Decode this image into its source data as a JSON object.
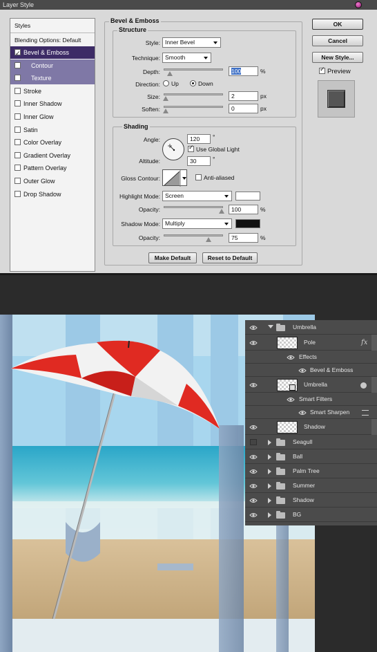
{
  "dialog": {
    "title": "Layer Style",
    "styles_panel": {
      "header": "Styles",
      "blending": "Blending Options: Default",
      "items": [
        {
          "label": "Bevel & Emboss",
          "checked": true,
          "selected": true
        },
        {
          "label": "Contour",
          "checked": false,
          "sub": true
        },
        {
          "label": "Texture",
          "checked": false,
          "sub": true
        },
        {
          "label": "Stroke",
          "checked": false
        },
        {
          "label": "Inner Shadow",
          "checked": false
        },
        {
          "label": "Inner Glow",
          "checked": false
        },
        {
          "label": "Satin",
          "checked": false
        },
        {
          "label": "Color Overlay",
          "checked": false
        },
        {
          "label": "Gradient Overlay",
          "checked": false
        },
        {
          "label": "Pattern Overlay",
          "checked": false
        },
        {
          "label": "Outer Glow",
          "checked": false
        },
        {
          "label": "Drop Shadow",
          "checked": false
        }
      ]
    },
    "bevel": {
      "section_title": "Bevel & Emboss",
      "structure_title": "Structure",
      "style_label": "Style:",
      "style_value": "Inner Bevel",
      "technique_label": "Technique:",
      "technique_value": "Smooth",
      "depth_label": "Depth:",
      "depth_value": "100",
      "depth_unit": "%",
      "direction_label": "Direction:",
      "direction_up": "Up",
      "direction_down": "Down",
      "direction_selected": "Down",
      "size_label": "Size:",
      "size_value": "2",
      "size_unit": "px",
      "soften_label": "Soften:",
      "soften_value": "0",
      "soften_unit": "px"
    },
    "shading": {
      "title": "Shading",
      "angle_label": "Angle:",
      "angle_value": "120",
      "degree": "°",
      "global_light_label": "Use Global Light",
      "global_light_checked": true,
      "altitude_label": "Altitude:",
      "altitude_value": "30",
      "gloss_label": "Gloss Contour:",
      "anti_aliased_label": "Anti-aliased",
      "anti_aliased_checked": false,
      "highlight_mode_label": "Highlight Mode:",
      "highlight_mode_value": "Screen",
      "highlight_color": "#ffffff",
      "opacity_label": "Opacity:",
      "highlight_opacity": "100",
      "shadow_mode_label": "Shadow Mode:",
      "shadow_mode_value": "Multiply",
      "shadow_color": "#111111",
      "shadow_opacity": "75",
      "percent": "%"
    },
    "make_default": "Make Default",
    "reset_default": "Reset to Default",
    "ok": "OK",
    "cancel": "Cancel",
    "new_style": "New Style...",
    "preview_label": "Preview",
    "preview_checked": true
  },
  "layers": [
    {
      "name": "Umbrella",
      "type": "group",
      "expanded": true,
      "visible": true
    },
    {
      "name": "Pole",
      "type": "layer",
      "fx": "fx",
      "visible": true
    },
    {
      "name": "Effects",
      "type": "effects-header"
    },
    {
      "name": "Bevel & Emboss",
      "type": "effect"
    },
    {
      "name": "Umbrella",
      "type": "smart-object",
      "visible": true
    },
    {
      "name": "Smart Filters",
      "type": "effects-header"
    },
    {
      "name": "Smart Sharpen",
      "type": "effect"
    },
    {
      "name": "Shadow",
      "type": "layer",
      "visible": true
    },
    {
      "name": "Seagull",
      "type": "group",
      "visible": false
    },
    {
      "name": "Ball",
      "type": "group",
      "visible": true
    },
    {
      "name": "Palm Tree",
      "type": "group",
      "visible": true
    },
    {
      "name": "Summer",
      "type": "group",
      "visible": true
    },
    {
      "name": "Shadow",
      "type": "group",
      "visible": true
    },
    {
      "name": "BG",
      "type": "group",
      "visible": true
    }
  ]
}
